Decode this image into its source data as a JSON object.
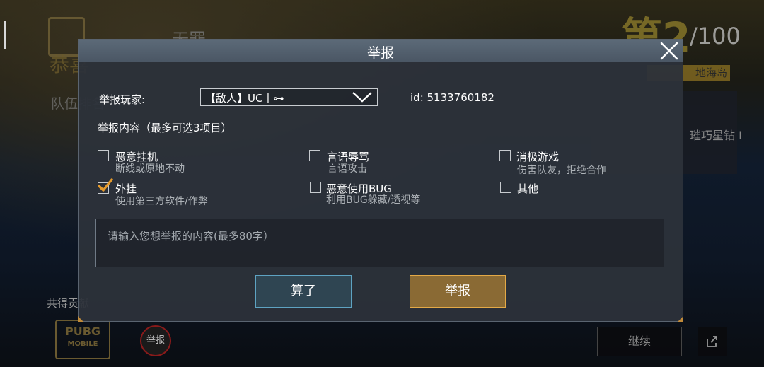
{
  "background": {
    "title": "恭喜",
    "player_name": "无罪",
    "subtitle": "队伍排名",
    "rank_number": "第2",
    "rank_total": "/100",
    "map_name": "地海岛",
    "tier_name": "璀巧星钻 I",
    "total_points_label": "共得贡献",
    "pubg_logo_text": "PUBG",
    "pubg_logo_sub": "MOBILE",
    "report_circle_label": "举报",
    "continue_label": "继续"
  },
  "modal": {
    "title": "举报",
    "player_label": "举报玩家:",
    "player_value": "【敌人】UC丨⊶",
    "player_id": "id: 5133760182",
    "content_label": "举报内容（最多可选3项目）",
    "options": [
      {
        "label": "恶意挂机",
        "desc": "断线或原地不动",
        "checked": false
      },
      {
        "label": "言语辱骂",
        "desc": "言语攻击",
        "checked": false
      },
      {
        "label": "消极游戏",
        "desc": "伤害队友，拒绝合作",
        "checked": false
      },
      {
        "label": "外挂",
        "desc": "使用第三方软件/作弊",
        "checked": true
      },
      {
        "label": "恶意使用BUG",
        "desc": "利用BUG躲藏/透视等",
        "checked": false
      },
      {
        "label": "其他",
        "desc": "",
        "checked": false
      }
    ],
    "textarea_placeholder": "请输入您想举报的内容(最多80字）",
    "cancel_label": "算了",
    "submit_label": "举报"
  },
  "colors": {
    "modal_bg": "#2c323a",
    "header": "#4a5664",
    "check_accent": "#e59a2c",
    "submit_bg": "#8a6a34",
    "submit_border": "#e3a947",
    "cancel_bg": "#2f4552",
    "cancel_border": "#5ea3c2"
  },
  "icons": {
    "close": "close-icon",
    "dropdown": "chevron-down-icon",
    "check": "checkmark-icon",
    "share": "share-icon"
  }
}
